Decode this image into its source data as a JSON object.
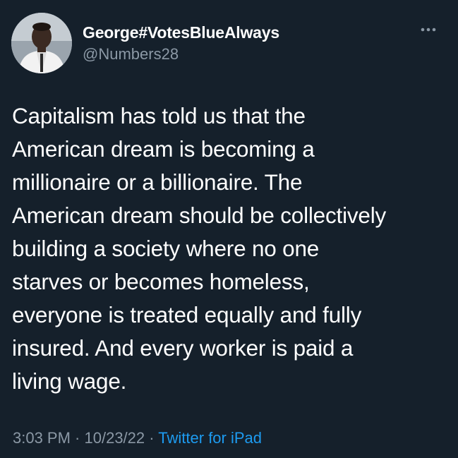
{
  "user": {
    "display_name": "George#VotesBlueAlways",
    "handle": "@Numbers28"
  },
  "tweet": {
    "lines": [
      "Capitalism has told us that the",
      "American dream is becoming a",
      "millionaire or a billionaire. The",
      "American dream should be collectively",
      "building a society where no one",
      "starves or becomes homeless,",
      "everyone is treated equally and fully",
      "insured. And every worker is paid a",
      "living wage."
    ]
  },
  "meta": {
    "time": "3:03 PM",
    "separator1": " · ",
    "date": "10/23/22",
    "separator2": " · ",
    "source": "Twitter for iPad"
  },
  "icons": {
    "more": "more-horizontal-icon",
    "avatar": "avatar"
  },
  "colors": {
    "background": "#15202b",
    "text": "#ffffff",
    "secondary": "#8b98a5",
    "link": "#1d9bf0"
  }
}
